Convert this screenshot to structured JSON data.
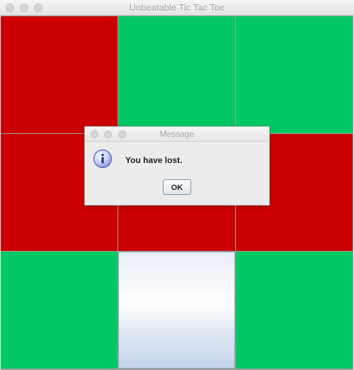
{
  "window": {
    "title": "Unbeatable Tic Tac Toe"
  },
  "board": {
    "cells": [
      {
        "state": "red"
      },
      {
        "state": "green"
      },
      {
        "state": "green"
      },
      {
        "state": "red"
      },
      {
        "state": "red"
      },
      {
        "state": "red"
      },
      {
        "state": "green"
      },
      {
        "state": "empty"
      },
      {
        "state": "green"
      }
    ],
    "colors": {
      "red": "#cc0000",
      "green": "#00c864"
    }
  },
  "dialog": {
    "title": "Message",
    "message": "You have lost.",
    "ok_label": "OK",
    "icon": "info-icon"
  }
}
